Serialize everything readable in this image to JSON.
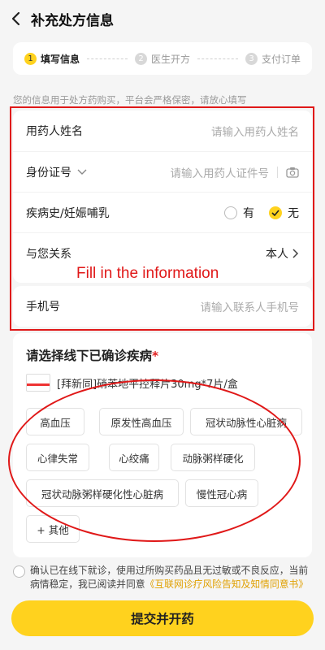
{
  "header": {
    "title": "补充处方信息"
  },
  "steps": [
    {
      "num": "1",
      "label": "填写信息",
      "active": true
    },
    {
      "num": "2",
      "label": "医生开方",
      "active": false
    },
    {
      "num": "3",
      "label": "支付订单",
      "active": false
    }
  ],
  "notice": "您的信息用于处方药购买，平台会严格保密，请放心填写",
  "form": {
    "name_label": "用药人姓名",
    "name_placeholder": "请输入用药人姓名",
    "id_label": "身份证号",
    "id_placeholder": "请输入用药人证件号",
    "history_label": "疾病史/妊娠哺乳",
    "history_yes": "有",
    "history_no": "无",
    "relation_label": "与您关系",
    "relation_value": "本人",
    "phone_label": "手机号",
    "phone_placeholder": "请输入联系人手机号"
  },
  "annotation": "Fill in the information",
  "disease": {
    "title": "请选择线下已确诊疾病",
    "required_mark": "*",
    "drug": "[拜新同]硝苯地平控释片30mg*7片/盒",
    "tags": [
      "高血压",
      "原发性高血压",
      "冠状动脉性心脏病",
      "心律失常",
      "心绞痛",
      "动脉粥样硬化",
      "冠状动脉粥样硬化性心脏病",
      "慢性冠心病",
      "+ 其他"
    ]
  },
  "consent": {
    "text": "确认已在线下就诊，使用过所购买药品且无过敏或不良反应，当前病情稳定，我已阅读并同意",
    "link": "《互联网诊疗风险告知及知情同意书》"
  },
  "submit_label": "提交并开药",
  "colors": {
    "accent": "#ffd21e",
    "annotation": "#e01818"
  }
}
